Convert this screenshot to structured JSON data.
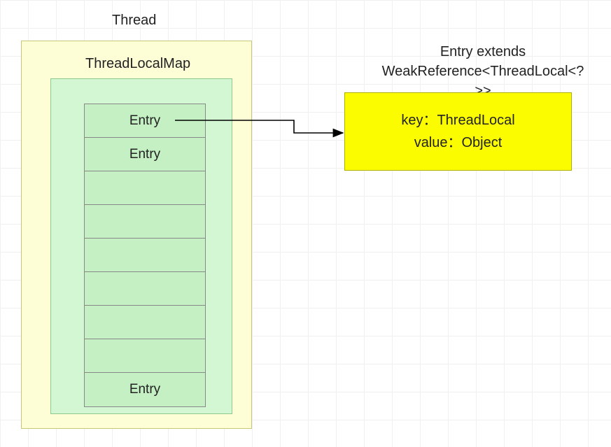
{
  "thread_label": "Thread",
  "tlm_label": "ThreadLocalMap",
  "entries": [
    {
      "label": "Entry"
    },
    {
      "label": "Entry"
    },
    {
      "label": ""
    },
    {
      "label": ""
    },
    {
      "label": ""
    },
    {
      "label": ""
    },
    {
      "label": ""
    },
    {
      "label": ""
    },
    {
      "label": "Entry"
    }
  ],
  "entry_title_line1": "Entry extends",
  "entry_title_line2": "WeakReference<ThreadLocal<?>>",
  "entry_box_line1": "key：ThreadLocal",
  "entry_box_line2": "value：Object"
}
